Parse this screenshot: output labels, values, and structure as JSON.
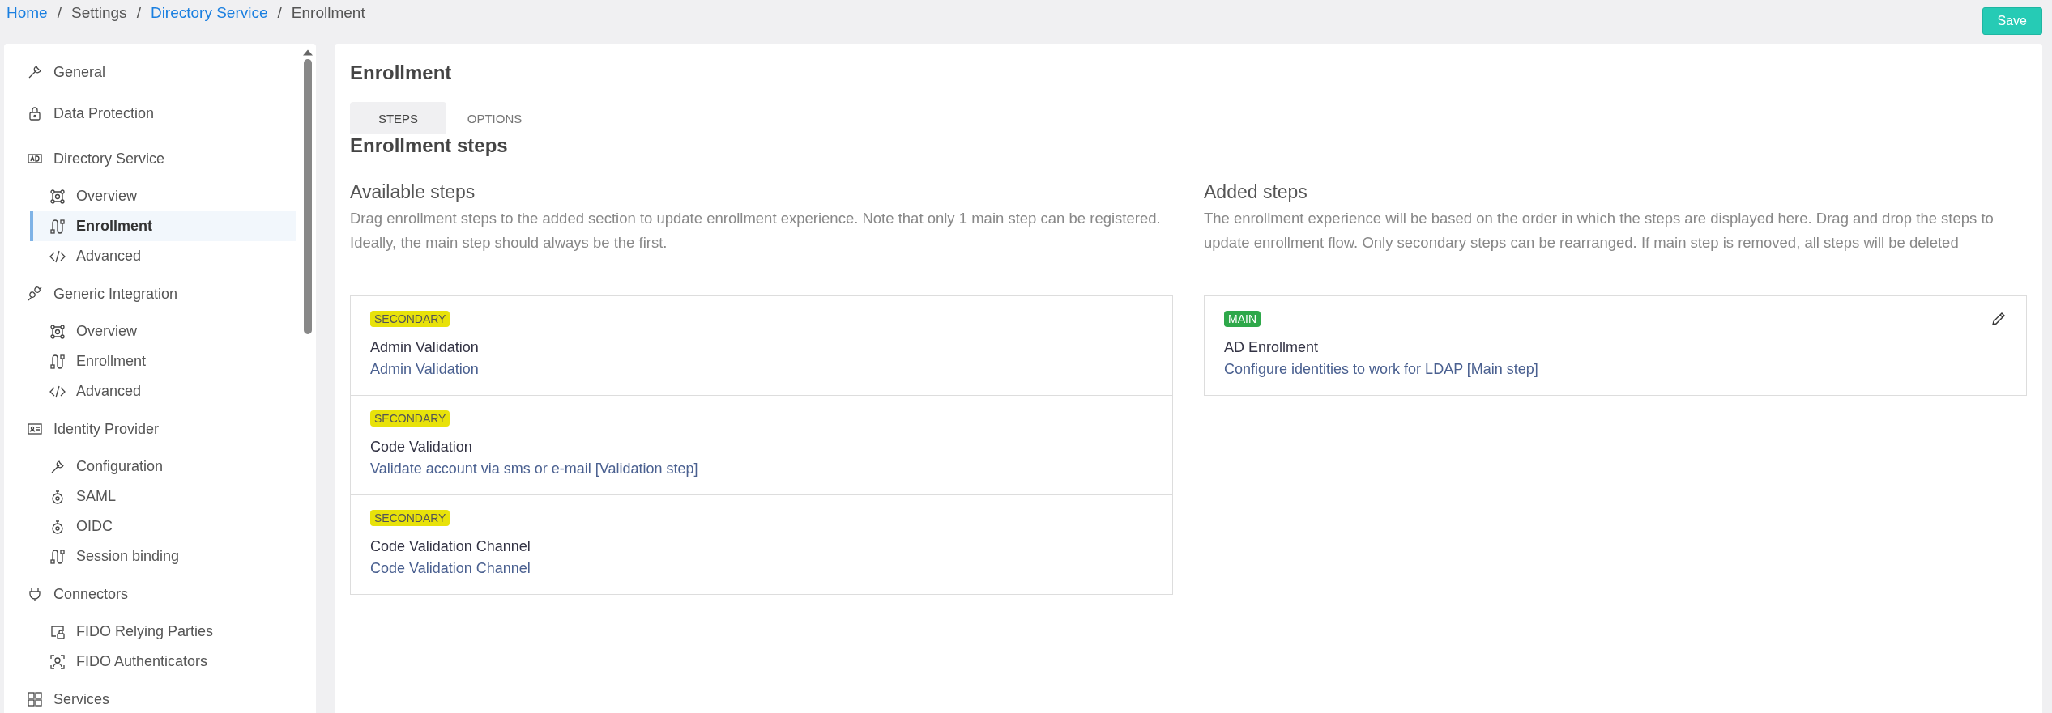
{
  "breadcrumb": [
    {
      "label": "Home",
      "link": true
    },
    {
      "separator": "/",
      "label": "Settings",
      "link": false
    },
    {
      "separator": "/",
      "label": "Directory Service",
      "link": true
    },
    {
      "separator": "/",
      "label": "Enrollment",
      "link": false
    }
  ],
  "save_button": "Save",
  "sidebar": {
    "items": [
      {
        "label": "General",
        "selected": false
      },
      {
        "label": "Data Protection",
        "selected": false
      },
      {
        "label": "Directory Service",
        "selected": false,
        "children": [
          {
            "label": "Overview",
            "selected": false
          },
          {
            "label": "Enrollment",
            "selected": true
          },
          {
            "label": "Advanced",
            "selected": false
          }
        ]
      },
      {
        "label": "Generic Integration",
        "selected": false,
        "children": [
          {
            "label": "Overview",
            "selected": false
          },
          {
            "label": "Enrollment",
            "selected": false
          },
          {
            "label": "Advanced",
            "selected": false
          }
        ]
      },
      {
        "label": "Identity Provider",
        "selected": false,
        "children": [
          {
            "label": "Configuration",
            "selected": false
          },
          {
            "label": "SAML",
            "selected": false
          },
          {
            "label": "OIDC",
            "selected": false
          },
          {
            "label": "Session binding",
            "selected": false
          }
        ]
      },
      {
        "label": "Connectors",
        "selected": false,
        "children": [
          {
            "label": "FIDO Relying Parties",
            "selected": false
          },
          {
            "label": "FIDO Authenticators",
            "selected": false
          }
        ]
      },
      {
        "label": "Services",
        "selected": false
      }
    ]
  },
  "page_title": "Enrollment",
  "tabs": [
    {
      "label": "STEPS",
      "selected": true
    },
    {
      "label": "OPTIONS",
      "selected": false
    }
  ],
  "section_title": "Enrollment steps",
  "available": {
    "title": "Available steps",
    "description": "Drag enrollment steps to the added section to update enrollment experience. Note that only 1 main step can be registered. Ideally, the main step should always be the first.",
    "steps": [
      {
        "kind": "secondary",
        "badge": "SECONDARY",
        "name": "Admin Validation",
        "description": "Admin Validation"
      },
      {
        "kind": "secondary",
        "badge": "SECONDARY",
        "name": "Code Validation",
        "description": "Validate account via sms or e-mail [Validation step]"
      },
      {
        "kind": "secondary",
        "badge": "SECONDARY",
        "name": "Code Validation Channel",
        "description": "Code Validation Channel"
      }
    ]
  },
  "added": {
    "title": "Added steps",
    "description": "The enrollment experience will be based on the order in which the steps are displayed here. Drag and drop the steps to update enrollment flow. Only secondary steps can be rearranged. If main step is removed, all steps will be deleted",
    "steps": [
      {
        "kind": "main",
        "badge": "MAIN",
        "name": "AD Enrollment",
        "description": "Configure identities to work for LDAP [Main step]"
      }
    ]
  }
}
